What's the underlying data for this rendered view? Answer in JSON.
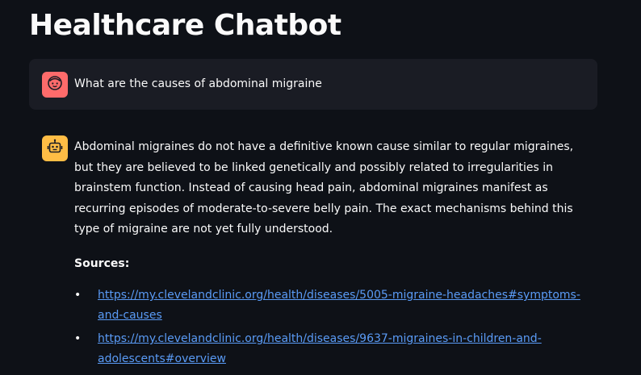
{
  "page": {
    "title": "Healthcare Chatbot"
  },
  "chat": {
    "user_message": {
      "avatar_icon": "face-icon",
      "avatar_color": "#ff6b6b",
      "text": "What are the causes of abdominal migraine"
    },
    "assistant_message": {
      "avatar_icon": "robot-icon",
      "avatar_color": "#ffbd45",
      "text": "Abdominal migraines do not have a definitive known cause similar to regular migraines, but they are believed to be linked genetically and possibly related to irregularities in brainstem function. Instead of causing head pain, abdominal migraines manifest as recurring episodes of moderate-to-severe belly pain. The exact mechanisms behind this type of migraine are not yet fully understood.",
      "sources_heading": "Sources:",
      "sources": [
        {
          "bullet": "•",
          "link": "https://my.clevelandclinic.org/health/diseases/5005-migraine-headaches#symptoms-and-causes"
        },
        {
          "bullet": "•",
          "link": "https://my.clevelandclinic.org/health/diseases/9637-migraines-in-children-and-adolescents#overview"
        }
      ]
    }
  },
  "colors": {
    "background": "#0e1117",
    "user_bubble": "#1a1c24",
    "link": "#5a9bf6",
    "text": "#fafafa"
  }
}
